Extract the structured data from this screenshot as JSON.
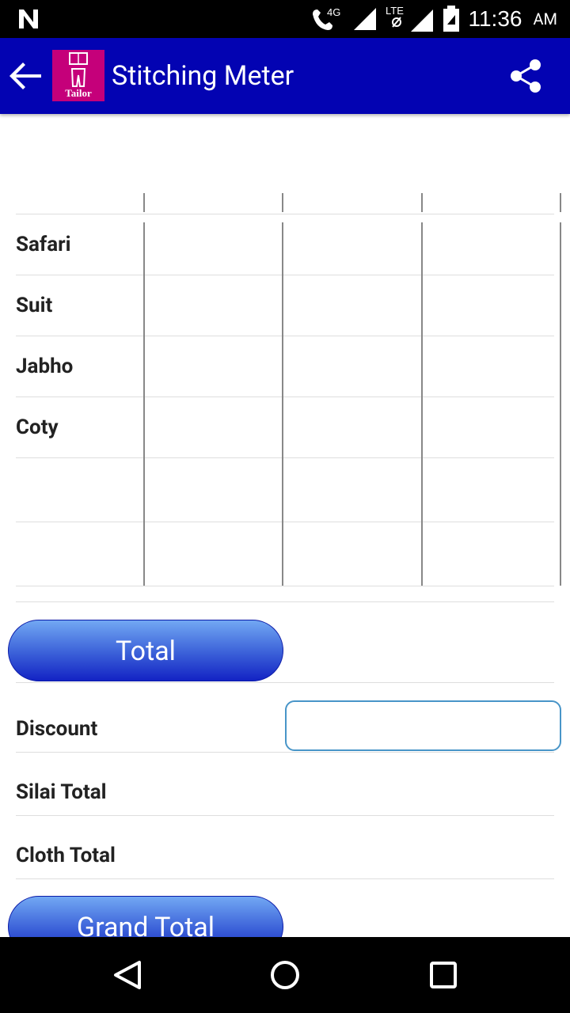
{
  "status_bar": {
    "time": "11:36",
    "ampm": "AM",
    "network": "4G",
    "network2": "LTE"
  },
  "toolbar": {
    "title": "Stitching Meter",
    "logo_text": "Tailor",
    "accent": "#0303b2"
  },
  "table": {
    "rows": [
      "Safari",
      "Suit",
      "Jabho",
      "Coty",
      "",
      ""
    ]
  },
  "buttons": {
    "total": "Total",
    "grand_total": "Grand Total"
  },
  "summary": {
    "discount_label": "Discount",
    "discount_value": "",
    "silai_total_label": "Silai Total",
    "cloth_total_label": "Cloth Total"
  }
}
